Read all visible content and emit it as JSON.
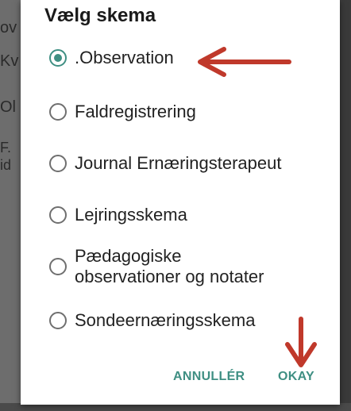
{
  "background": {
    "fragments": [
      "ov",
      "Kv",
      "Ol",
      "F.",
      "id"
    ]
  },
  "dialog": {
    "title": "Vælg skema",
    "options": [
      {
        "label": ".Observation",
        "selected": true
      },
      {
        "label": "Faldregistrering",
        "selected": false
      },
      {
        "label": "Journal Ernæringsterapeut",
        "selected": false
      },
      {
        "label": "Lejringsskema",
        "selected": false
      },
      {
        "label_line1": "Pædagogiske",
        "label_line2": "observationer og notater",
        "selected": false
      },
      {
        "label": "Sondeernæringsskema",
        "selected": false
      }
    ],
    "cancel_label": "ANNULLÉR",
    "ok_label": "OKAY"
  },
  "colors": {
    "accent": "#3f8f83",
    "annotation_arrow": "#c0392b",
    "dialog_bg": "#ffffff",
    "scrim": "#6d6d6d"
  },
  "icons": {
    "radio_selected": "radio-selected-icon",
    "radio_unselected": "radio-unselected-icon",
    "annotation": "red-arrow-icon"
  }
}
